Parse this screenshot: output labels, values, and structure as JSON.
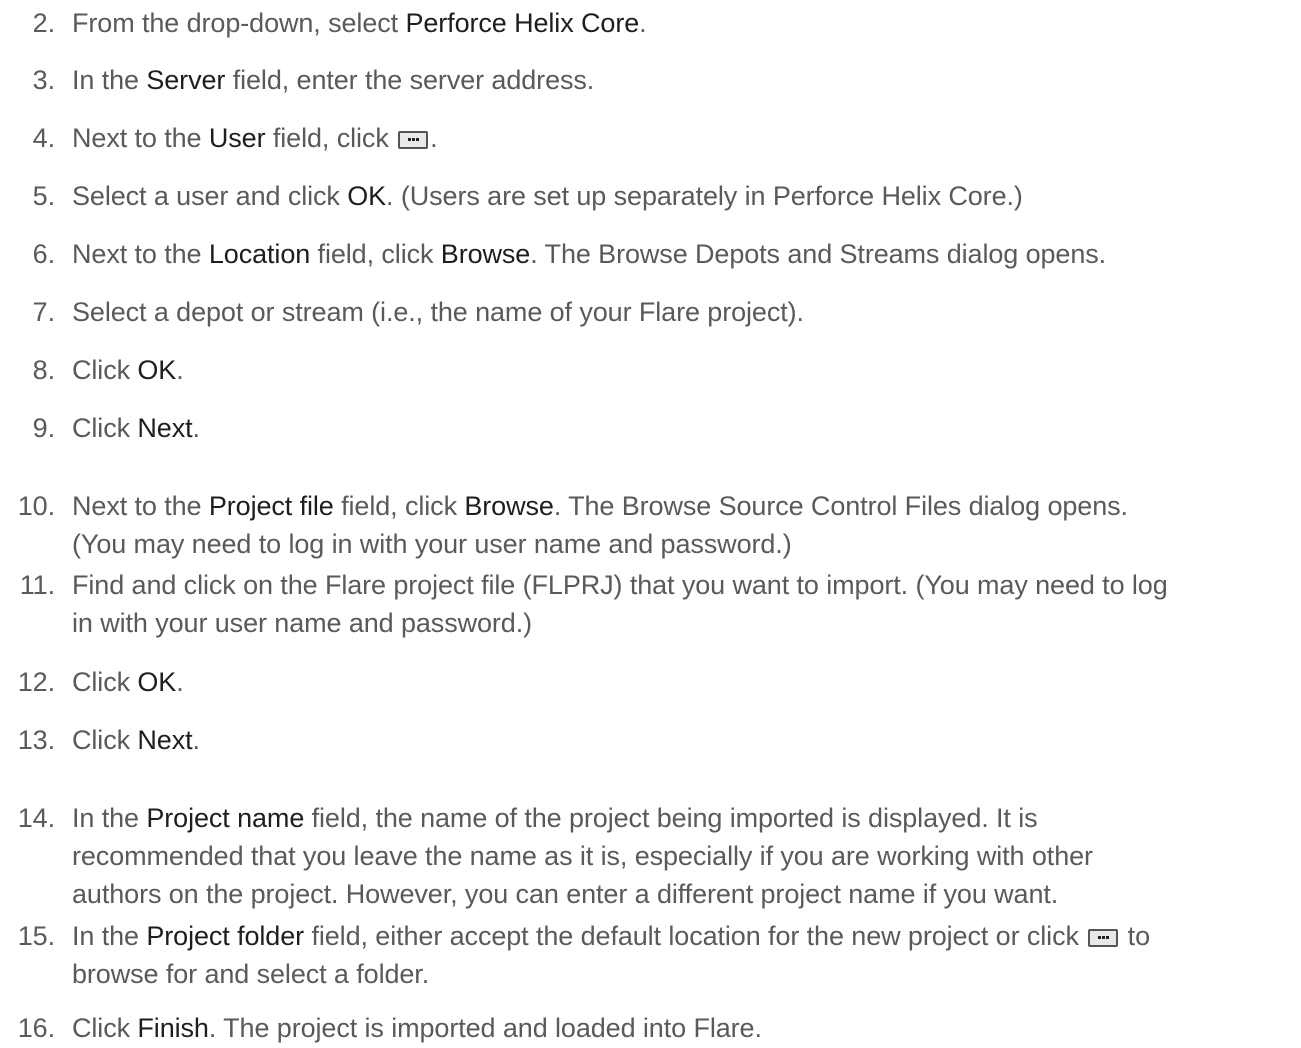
{
  "steps": [
    {
      "n": "2.",
      "parts": [
        {
          "t": "From the drop-down, select "
        },
        {
          "t": "Perforce Helix Core",
          "b": true
        },
        {
          "t": "."
        }
      ]
    },
    {
      "n": "3.",
      "parts": [
        {
          "t": "In the "
        },
        {
          "t": "Server",
          "b": true
        },
        {
          "t": " field, enter the server address."
        }
      ]
    },
    {
      "n": "4.",
      "parts": [
        {
          "t": "Next to the "
        },
        {
          "t": "User",
          "b": true
        },
        {
          "t": " field, click "
        },
        {
          "icon": "ellipsis-button-icon"
        },
        {
          "t": "."
        }
      ]
    },
    {
      "n": "5.",
      "parts": [
        {
          "t": "Select a user and click "
        },
        {
          "t": "OK",
          "b": true
        },
        {
          "t": ". (Users are set up separately in Perforce Helix Core.)"
        }
      ]
    },
    {
      "n": "6.",
      "parts": [
        {
          "t": "Next to the "
        },
        {
          "t": "Location",
          "b": true
        },
        {
          "t": " field, click "
        },
        {
          "t": "Browse",
          "b": true
        },
        {
          "t": ". The Browse Depots and Streams dialog opens."
        }
      ]
    },
    {
      "n": "7.",
      "parts": [
        {
          "t": "Select a depot or stream (i.e., the name of your Flare project)."
        }
      ]
    },
    {
      "n": "8.",
      "parts": [
        {
          "t": "Click "
        },
        {
          "t": "OK",
          "b": true
        },
        {
          "t": "."
        }
      ]
    },
    {
      "n": "9.",
      "parts": [
        {
          "t": "Click "
        },
        {
          "t": "Next",
          "b": true
        },
        {
          "t": "."
        }
      ]
    },
    {
      "n": "10.",
      "parts": [
        {
          "t": "Next to the "
        },
        {
          "t": "Project file",
          "b": true
        },
        {
          "t": " field, click "
        },
        {
          "t": "Browse",
          "b": true
        },
        {
          "t": ". The Browse Source Control Files dialog opens."
        },
        {
          "br": true
        },
        {
          "t": "(You may need to log in with your user name and password.)"
        }
      ]
    },
    {
      "n": "11.",
      "parts": [
        {
          "t": "Find and click on the Flare project file (FLPRJ) that you want to import. (You may need to log"
        },
        {
          "br": true
        },
        {
          "t": "in with your user name and password.)"
        }
      ]
    },
    {
      "n": "12.",
      "parts": [
        {
          "t": "Click "
        },
        {
          "t": "OK",
          "b": true
        },
        {
          "t": "."
        }
      ]
    },
    {
      "n": "13.",
      "parts": [
        {
          "t": "Click "
        },
        {
          "t": "Next",
          "b": true
        },
        {
          "t": "."
        }
      ]
    },
    {
      "n": "14.",
      "parts": [
        {
          "t": "In the "
        },
        {
          "t": "Project name",
          "b": true
        },
        {
          "t": " field, the name of the project being imported is displayed. It is"
        },
        {
          "br": true
        },
        {
          "t": "recommended that you leave the name as it is, especially if you are working with other"
        },
        {
          "br": true
        },
        {
          "t": "authors on the project. However, you can enter a different project name if you want."
        }
      ]
    },
    {
      "n": "15.",
      "parts": [
        {
          "t": "In the "
        },
        {
          "t": "Project folder",
          "b": true
        },
        {
          "t": " field, either accept the default location for the new project or click "
        },
        {
          "icon": "ellipsis-button-icon"
        },
        {
          "t": " to"
        },
        {
          "br": true
        },
        {
          "t": "browse for and select a folder."
        }
      ]
    },
    {
      "n": "16.",
      "parts": [
        {
          "t": "Click "
        },
        {
          "t": "Finish",
          "b": true
        },
        {
          "t": ". The project is imported and loaded into Flare."
        }
      ]
    }
  ]
}
